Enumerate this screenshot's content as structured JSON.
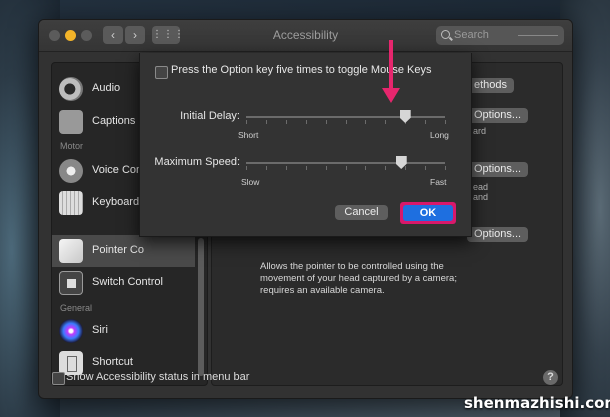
{
  "window": {
    "title": "Accessibility",
    "search_placeholder": "Search",
    "nav_back": "‹",
    "nav_forward": "›",
    "grid_icon": "⋮⋮⋮"
  },
  "sidebar": {
    "items": [
      {
        "label": "Audio",
        "icon": "speaker-icon"
      },
      {
        "label": "Captions",
        "icon": "captions-icon"
      },
      {
        "label": "Voice Con",
        "icon": "voice-control-icon"
      },
      {
        "label": "Keyboard",
        "icon": "keyboard-icon"
      },
      {
        "label": "Pointer Co",
        "icon": "pointer-icon",
        "selected": true
      },
      {
        "label": "Switch Control",
        "icon": "switch-control-icon"
      },
      {
        "label": "Siri",
        "icon": "siri-icon"
      },
      {
        "label": "Shortcut",
        "icon": "shortcut-icon"
      }
    ],
    "section_motor": "Motor",
    "section_general": "General"
  },
  "panel": {
    "methods_btn": "ethods",
    "options_btn_1": "Options...",
    "options_btn_2": "Options...",
    "options_btn_3": "Options...",
    "partial_1": "ard",
    "partial_2": "ead",
    "partial_3": "and",
    "head_description": "Allows the pointer to be controlled using the movement of your head captured by a camera; requires an available camera."
  },
  "footer": {
    "status_checkbox_label": "Show Accessibility status in menu bar",
    "help": "?"
  },
  "sheet": {
    "toggle_label": "Press the Option key five times to toggle Mouse Keys",
    "initial_delay_label": "Initial Delay:",
    "initial_delay_min": "Short",
    "initial_delay_max": "Long",
    "initial_delay_value": 0.8,
    "max_speed_label": "Maximum Speed:",
    "max_speed_min": "Slow",
    "max_speed_max": "Fast",
    "max_speed_value": 0.78,
    "cancel": "Cancel",
    "ok": "OK"
  },
  "watermark": "shenmazhishi.com",
  "colors": {
    "annotation_arrow": "#e6266d",
    "ok_highlight": "#d8186b",
    "ok_button": "#1e6fe0"
  }
}
